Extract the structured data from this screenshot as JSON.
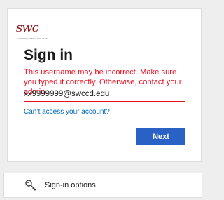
{
  "logo": {
    "text": "swc",
    "subtext": "SOUTHWESTERN COLLEGE",
    "color": "#8a1414"
  },
  "signin": {
    "title": "Sign in",
    "error_message": "This username may be incorrect. Make sure you typed it correctly. Otherwise, contact your admin.",
    "username_value": "xx9999999@swccd.edu",
    "cant_access_link": "Can’t access your account?",
    "next_label": "Next"
  },
  "options": {
    "label": "Sign-in options",
    "icon": "key-icon"
  },
  "colors": {
    "error": "#e81123",
    "link": "#0067b8",
    "primary_button": "#2a61c4",
    "background": "#eeeeee"
  }
}
